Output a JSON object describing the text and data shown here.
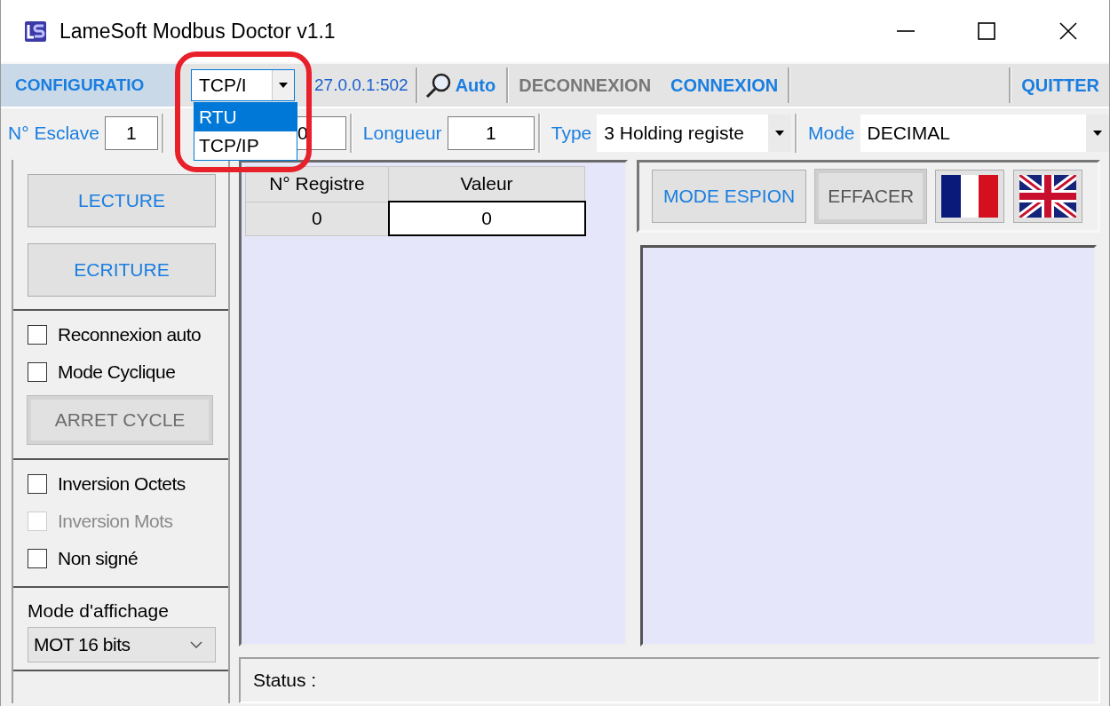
{
  "window": {
    "title": "LameSoft Modbus Doctor v1.1"
  },
  "toolbar": {
    "configuration": {
      "label": "CONFIGURATIO",
      "selected": true
    },
    "protocol": {
      "value": "TCP/I",
      "expanded": true,
      "options": [
        {
          "label": "RTU",
          "selected": true
        },
        {
          "label": "TCP/IP",
          "selected": false
        }
      ]
    },
    "address": "27.0.0.1:502",
    "auto": "Auto",
    "actions": [
      {
        "label": "DECONNEXION",
        "disabled": true
      },
      {
        "label": "CONNEXION",
        "disabled": false
      }
    ],
    "quit": {
      "label": "QUITTER",
      "disabled": false
    }
  },
  "params": [
    {
      "kind": "number",
      "label": "N° Esclave",
      "value": "1"
    },
    {
      "kind": "number",
      "value": "0"
    },
    {
      "kind": "number",
      "label": "Longueur",
      "value": "1"
    },
    {
      "kind": "select",
      "label": "Type",
      "value": "3 Holding registe"
    },
    {
      "kind": "select",
      "label": "Mode",
      "value": "DECIMAL"
    }
  ],
  "left_panel": {
    "buttons": [
      {
        "label": "LECTURE",
        "disabled": false
      },
      {
        "label": "ECRITURE",
        "disabled": false
      }
    ],
    "cycle_options": [
      {
        "label": "Reconnexion auto",
        "checked": false,
        "disabled": false
      },
      {
        "label": "Mode Cyclique",
        "checked": false,
        "disabled": false
      }
    ],
    "stop_button": {
      "label": "ARRET CYCLE",
      "disabled": true
    },
    "format_options": [
      {
        "label": "Inversion Octets",
        "checked": false,
        "disabled": false
      },
      {
        "label": "Inversion Mots",
        "checked": false,
        "disabled": true
      },
      {
        "label": "Non signé",
        "checked": false,
        "disabled": false
      }
    ],
    "display_mode": {
      "label": "Mode d'affichage",
      "value": "MOT 16 bits"
    }
  },
  "table": {
    "columns": [
      "N° Registre",
      "Valeur"
    ],
    "rows": [
      {
        "cells": [
          "0",
          "0"
        ]
      }
    ]
  },
  "spy_panel": {
    "buttons": [
      {
        "label": "MODE ESPION",
        "disabled": false
      },
      {
        "label": "EFFACER",
        "disabled": true
      }
    ],
    "languages": [
      {
        "kind": "french"
      },
      {
        "kind": "english"
      }
    ]
  },
  "status_bar": {
    "text": "Status :"
  }
}
